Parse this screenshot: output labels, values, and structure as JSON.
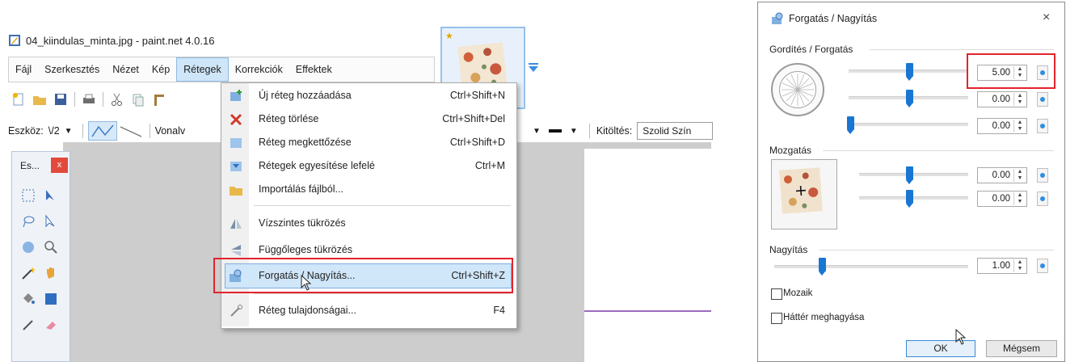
{
  "app": {
    "title": "04_kiindulas_minta.jpg - paint.net 4.0.16",
    "menu": [
      "Fájl",
      "Szerkesztés",
      "Nézet",
      "Kép",
      "Rétegek",
      "Korrekciók",
      "Effektek"
    ],
    "active_menu_index": 4,
    "toolbar2": {
      "tool_label": "Eszköz:",
      "tool_value": "\\/2",
      "line_label": "Vonalv",
      "fill_label": "Kitöltés:",
      "fill_value": "Szolid Szín"
    },
    "tools_panel": {
      "title": "Es...",
      "close": "x"
    },
    "layers_menu": [
      {
        "label": "Új réteg hozzáadása",
        "shortcut": "Ctrl+Shift+N",
        "icon": "add-layer-icon"
      },
      {
        "label": "Réteg törlése",
        "shortcut": "Ctrl+Shift+Del",
        "icon": "delete-layer-icon"
      },
      {
        "label": "Réteg megkettőzése",
        "shortcut": "Ctrl+Shift+D",
        "icon": "duplicate-layer-icon"
      },
      {
        "label": "Rétegek egyesítése lefelé",
        "shortcut": "Ctrl+M",
        "icon": "merge-layer-icon"
      },
      {
        "label": "Importálás fájlból...",
        "shortcut": "",
        "icon": "import-file-icon"
      },
      {
        "label": "Vízszintes tükrözés",
        "shortcut": "",
        "icon": "flip-horizontal-icon"
      },
      {
        "label": "Függőleges tükrözés",
        "shortcut": "",
        "icon": "flip-vertical-icon"
      },
      {
        "label": "Forgatás / Nagyítás...",
        "shortcut": "Ctrl+Shift+Z",
        "icon": "rotate-zoom-icon"
      },
      {
        "label": "Réteg tulajdonságai...",
        "shortcut": "F4",
        "icon": "layer-properties-icon"
      }
    ],
    "highlighted_menu_index": 7
  },
  "dialog": {
    "title": "Forgatás / Nagyítás",
    "close": "×",
    "group_rotate": "Gordítés / Forgatás",
    "rotate_values": [
      "5.00",
      "0.00",
      "0.00"
    ],
    "group_pan": "Mozgatás",
    "pan_values": [
      "0.00",
      "0.00"
    ],
    "group_zoom": "Nagyítás",
    "zoom_value": "1.00",
    "checkbox_tile": "Mozaik",
    "checkbox_keep_bg": "Háttér meghagyása",
    "ok": "OK",
    "cancel": "Mégsem"
  },
  "colors": {
    "accent_blue": "#1976d2",
    "highlight": "#d0e6f9",
    "annotation_red": "#e4232b"
  }
}
